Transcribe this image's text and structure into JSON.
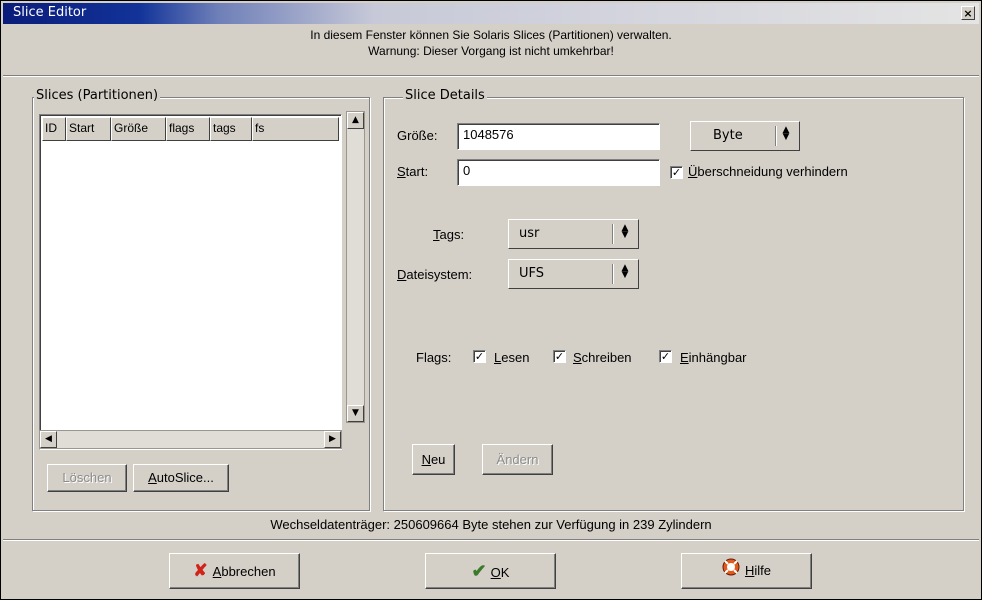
{
  "window": {
    "title": "Slice Editor",
    "close_glyph": "×"
  },
  "info": {
    "line1": "In diesem Fenster können Sie Solaris Slices (Partitionen) verwalten.",
    "line2": "Warnung: Dieser Vorgang ist nicht umkehrbar!"
  },
  "slices": {
    "frame_label": "Slices (Partitionen)",
    "columns": [
      "ID",
      "Start",
      "Größe",
      "flags",
      "tags",
      "fs"
    ],
    "delete_label": "Löschen",
    "autoslice_label_mnemonic": "A",
    "autoslice_label_rest": "utoSlice..."
  },
  "details": {
    "frame_label": "Slice Details",
    "size_label": "Größe:",
    "size_value": "1048576",
    "unit_value": "Byte",
    "start_label_mnemonic": "S",
    "start_label_rest": "tart:",
    "start_value": "0",
    "overlap_mnemonic": "Ü",
    "overlap_rest": "berschneidung verhindern",
    "overlap_checked": true,
    "tags_label_mnemonic": "T",
    "tags_label_rest": "ags:",
    "tags_value": "usr",
    "fs_label_mnemonic": "D",
    "fs_label_rest": "ateisystem:",
    "fs_value": "UFS",
    "flags_label": "Flags:",
    "flag_read_mnemonic": "L",
    "flag_read_rest": "esen",
    "flag_write_mnemonic": "S",
    "flag_write_rest": "chreiben",
    "flag_mount_mnemonic": "E",
    "flag_mount_rest": "inhängbar",
    "new_mnemonic": "N",
    "new_rest": "eu",
    "change_label": "Ändern"
  },
  "status": "Wechseldatenträger: 250609664 Byte stehen zur Verfügung in 239 Zylindern",
  "buttons": {
    "cancel_mnemonic": "A",
    "cancel_rest": "bbrechen",
    "ok_mnemonic": "O",
    "ok_rest": "K",
    "help_mnemonic": "H",
    "help_rest": "ilfe"
  },
  "icons": {
    "cancel": "red-x-icon",
    "ok": "green-check-icon",
    "help": "lifebuoy-icon"
  },
  "colors": {
    "title_bar": "#0a1c7a",
    "window_bg": "#d4d0c8",
    "cancel_icon": "#d0231a",
    "ok_icon": "#3a7a2a",
    "help_icon": "#e05a1c"
  }
}
